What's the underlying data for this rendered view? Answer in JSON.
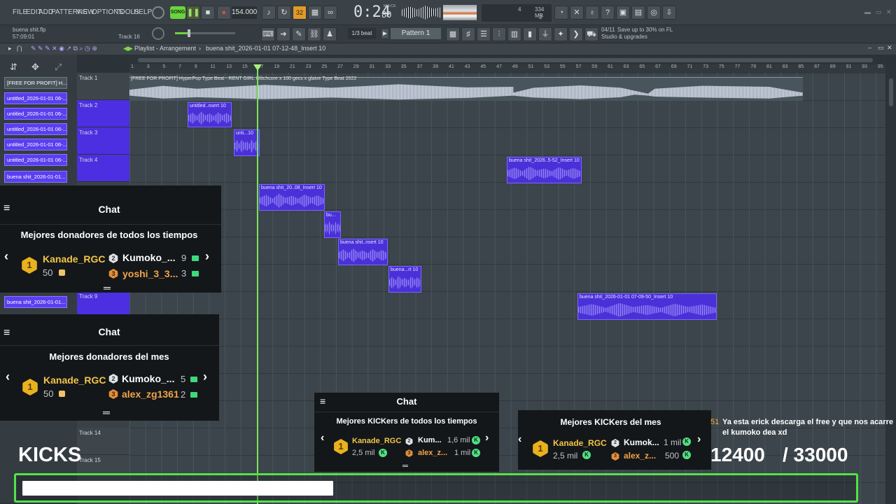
{
  "menu": [
    "FILE",
    "EDIT",
    "ADD",
    "PATTERNS",
    "VIEW",
    "OPTIONS",
    "TOOLS",
    "HELP"
  ],
  "transport": {
    "song_label": "SONG",
    "tempo": "154.000",
    "time": "0:24",
    "time_sub": "80",
    "time_unit": "M:S:CS",
    "pattern_num": "32",
    "cpu": "4",
    "ram": "334 MB",
    "poly": "2"
  },
  "project": {
    "file": "buena shit.flp",
    "elapsed": "57:09:01",
    "hint_track": "Track 16"
  },
  "toolbar": {
    "snap": "1/3 beat",
    "pattern": "Pattern 1",
    "news_count": "04/11",
    "news_text_1": "Save up to 30% on FL",
    "news_text_2": "Studio & upgrades"
  },
  "playlist": {
    "title": "Playlist - Arrangement",
    "breadcrumb": "buena shit_2026-01-01 07-12-48_Insert 10"
  },
  "ruler": [
    "1",
    "3",
    "5",
    "7",
    "9",
    "11",
    "13",
    "15",
    "17",
    "19",
    "21",
    "23",
    "25",
    "27",
    "29",
    "31",
    "33",
    "35",
    "37",
    "39",
    "41",
    "43",
    "45",
    "47",
    "49",
    "51",
    "53",
    "55",
    "57",
    "59",
    "61",
    "63",
    "65",
    "67",
    "69",
    "71",
    "73",
    "75",
    "77",
    "79",
    "81",
    "83",
    "85",
    "87",
    "89",
    "91",
    "93",
    "95"
  ],
  "picker": [
    "[FREE FOR PROFIT] H...",
    "untitled_2026-01-01 06-...",
    "untitled_2026-01-01 06-...",
    "untitled_2026-01-01 06-...",
    "untitled_2026-01-01 06-...",
    "untitled_2026-01-01 06-...",
    "buena shit_2026-01-01...",
    "buena shit_2026-01-01..."
  ],
  "tracks": [
    "Track 1",
    "Track 2",
    "Track 3",
    "Track 4",
    "Track 9",
    "Track 14",
    "Track 15"
  ],
  "clips": {
    "c1": "[FREE FOR PROFIT] HyperPop Type Beat - RENT GIRL Glitchcore x 100 gecs x glaive Type Beat 2022",
    "c2": "untitled..nsert 10",
    "c3": "unti...10",
    "c4": "buena shit_2026..5-52_Insert 10",
    "c5": "buena shit_20..08_Insert 10",
    "c6": "bu...",
    "c7": "buena shit..nsert 10",
    "c8": "buena...rt 10",
    "c9": "buena shit_2026-01-01 07-09-50_Insert 10"
  },
  "chat1": {
    "title": "Chat",
    "heading": "Mejores donadores de todos los tiempos",
    "first_name": "Kanade_RGC",
    "first_val": "50",
    "second_name": "Kumoko_...",
    "second_val": "9",
    "third_name": "yoshi_3_3...",
    "third_val": "3"
  },
  "chat2": {
    "title": "Chat",
    "heading": "Mejores donadores del mes",
    "first_name": "Kanade_RGC",
    "first_val": "50",
    "second_name": "Kumoko_...",
    "second_val": "5",
    "third_name": "alex_zg1361",
    "third_val": "2"
  },
  "chat3": {
    "title": "Chat",
    "heading": "Mejores KICKers de todos los tiempos",
    "first_name": "Kanade_RGC",
    "first_val": "2,5 mil",
    "second_name": "Kum...",
    "second_val": "1,6 mil",
    "third_name": "alex_z...",
    "third_val": "1 mil"
  },
  "chat4": {
    "heading": "Mejores KICKers del mes",
    "first_name": "Kanade_RGC",
    "first_val": "2,5 mil",
    "second_name": "Kumok...",
    "second_val": "1 mil",
    "third_name": "alex_z...",
    "third_val": "500"
  },
  "message": {
    "prefix": "51",
    "text": "Ya esta erick descarga el free y que nos acarre el kumoko dea xd"
  },
  "kicks": {
    "label": "KICKS",
    "current": "12400",
    "goal": "/ 33000",
    "progress": 0.376
  }
}
